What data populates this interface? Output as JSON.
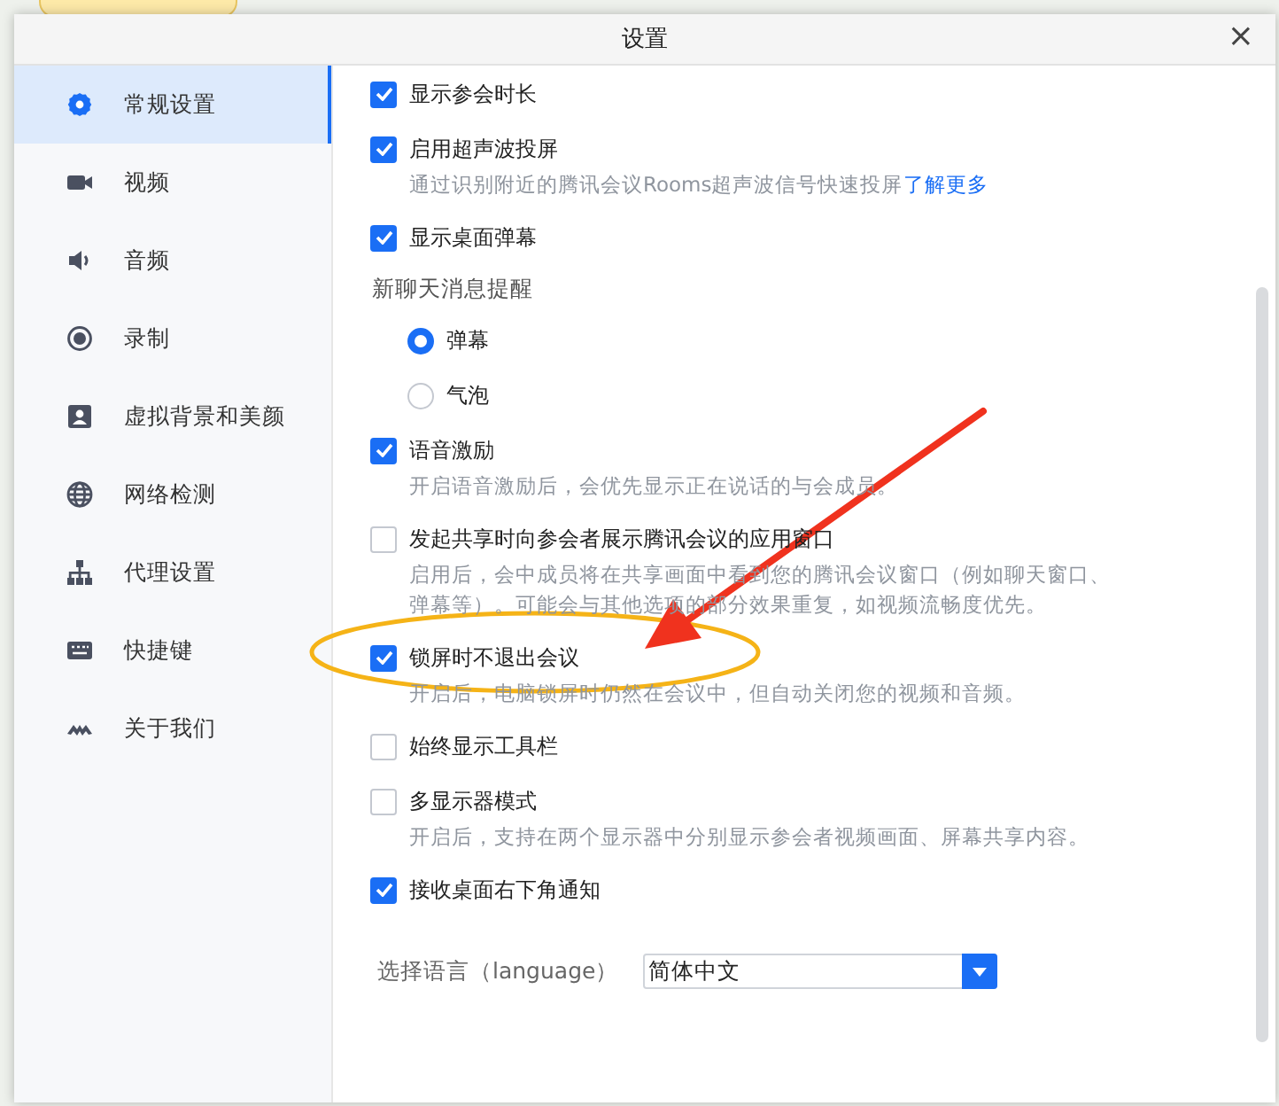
{
  "window": {
    "title": "设置",
    "close": "×"
  },
  "sidebar": {
    "items": [
      {
        "label": "常规设置",
        "selected": true
      },
      {
        "label": "视频",
        "selected": false
      },
      {
        "label": "音频",
        "selected": false
      },
      {
        "label": "录制",
        "selected": false
      },
      {
        "label": "虚拟背景和美颜",
        "selected": false
      },
      {
        "label": "网络检测",
        "selected": false
      },
      {
        "label": "代理设置",
        "selected": false
      },
      {
        "label": "快捷键",
        "selected": false
      },
      {
        "label": "关于我们",
        "selected": false
      }
    ]
  },
  "settings": [
    {
      "kind": "checkbox",
      "label": "显示参会时长",
      "checked": true
    },
    {
      "kind": "checkbox",
      "label": "启用超声波投屏",
      "checked": true,
      "description": "通过识别附近的腾讯会议Rooms超声波信号快速投屏",
      "link": "了解更多"
    },
    {
      "kind": "checkbox",
      "label": "显示桌面弹幕",
      "checked": true
    },
    {
      "kind": "heading",
      "label": "新聊天消息提醒"
    },
    {
      "kind": "radio",
      "label": "弹幕",
      "selected": true
    },
    {
      "kind": "radio",
      "label": "气泡",
      "selected": false
    },
    {
      "kind": "checkbox",
      "label": "语音激励",
      "checked": true,
      "description": "开启语音激励后，会优先显示正在说话的与会成员。"
    },
    {
      "kind": "checkbox",
      "label": "发起共享时向参会者展示腾讯会议的应用窗口",
      "checked": false,
      "description": "启用后，会中成员将在共享画面中看到您的腾讯会议窗口（例如聊天窗口、弹幕等）。可能会与其他选项的部分效果重复，如视频流畅度优先。"
    },
    {
      "kind": "checkbox",
      "label": "锁屏时不退出会议",
      "checked": true,
      "description": "开启后，电脑锁屏时仍然在会议中，但自动关闭您的视频和音频。"
    },
    {
      "kind": "checkbox",
      "label": "始终显示工具栏",
      "checked": false
    },
    {
      "kind": "checkbox",
      "label": "多显示器模式",
      "checked": false,
      "description": "开启后，支持在两个显示器中分别显示参会者视频画面、屏幕共享内容。"
    },
    {
      "kind": "checkbox",
      "label": "接收桌面右下角通知",
      "checked": true
    }
  ],
  "language": {
    "label": "选择语言（language）",
    "value": "简体中文"
  }
}
